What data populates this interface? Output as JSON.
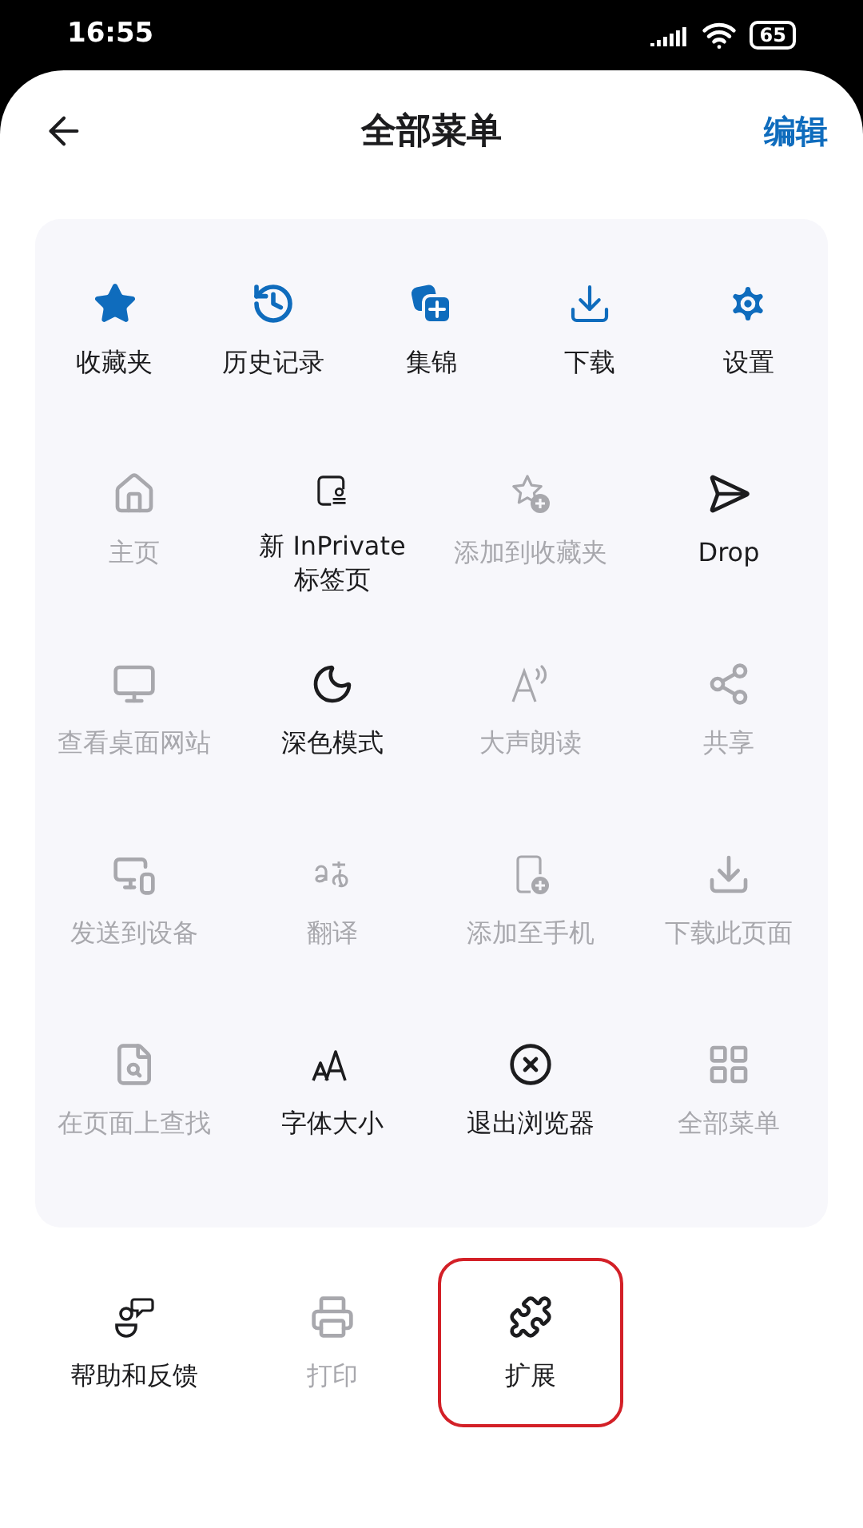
{
  "status_bar": {
    "time": "16:55",
    "battery": "65"
  },
  "header": {
    "title": "全部菜单",
    "action": "编辑"
  },
  "pinned": [
    {
      "label": "收藏夹"
    },
    {
      "label": "历史记录"
    },
    {
      "label": "集锦"
    },
    {
      "label": "下载"
    },
    {
      "label": "设置"
    }
  ],
  "menu_items": [
    {
      "label": "主页",
      "disabled": true
    },
    {
      "label": "新 InPrivate 标签页",
      "disabled": false
    },
    {
      "label": "添加到收藏夹",
      "disabled": true
    },
    {
      "label": "Drop",
      "disabled": false
    },
    {
      "label": "查看桌面网站",
      "disabled": true
    },
    {
      "label": "深色模式",
      "disabled": false
    },
    {
      "label": "大声朗读",
      "disabled": true
    },
    {
      "label": "共享",
      "disabled": true
    },
    {
      "label": "发送到设备",
      "disabled": true
    },
    {
      "label": "翻译",
      "disabled": true
    },
    {
      "label": "添加至手机",
      "disabled": true
    },
    {
      "label": "下载此页面",
      "disabled": true
    },
    {
      "label": "在页面上查找",
      "disabled": true
    },
    {
      "label": "字体大小",
      "disabled": false
    },
    {
      "label": "退出浏览器",
      "disabled": false
    },
    {
      "label": "全部菜单",
      "disabled": true
    }
  ],
  "extra_items": [
    {
      "label": "帮助和反馈",
      "disabled": false,
      "highlighted": false
    },
    {
      "label": "打印",
      "disabled": true,
      "highlighted": false
    },
    {
      "label": "扩展",
      "disabled": false,
      "highlighted": true
    }
  ]
}
